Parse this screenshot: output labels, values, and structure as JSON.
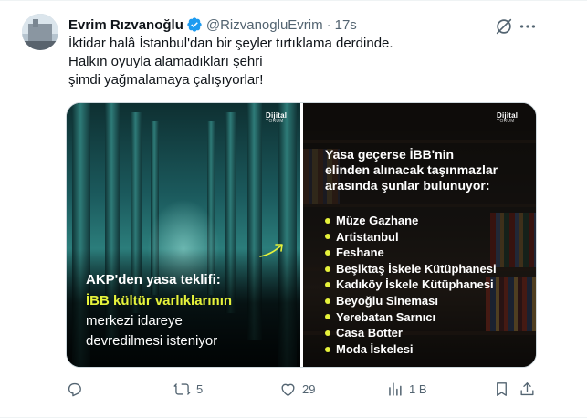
{
  "tweet": {
    "author_name": "Evrim Rızvanoğlu",
    "handle": "@RizvanogluEvrim",
    "separator": "·",
    "time": "17s",
    "text_lines": [
      "İktidar halâ İstanbul'dan bir şeyler tırtıklama derdinde.",
      "Halkın oyuyla alamadıkları şehri",
      "şimdi yağmalamaya çalışıyorlar!"
    ]
  },
  "media": {
    "left": {
      "logo": "Dijital",
      "logo_sub": "YORUM",
      "headline": "AKP'den yasa teklifi:",
      "highlight": "İBB kültür varlıklarının",
      "line3": "merkezi idareye",
      "line4": "devredilmesi isteniyor"
    },
    "right": {
      "logo": "Dijital",
      "logo_sub": "YORUM",
      "intro_lines": [
        "Yasa geçerse İBB'nin",
        "elinden alınacak taşınmazlar",
        "arasında şunlar bulunuyor:"
      ],
      "items": [
        "Müze Gazhane",
        "Artistanbul",
        "Feshane",
        "Beşiktaş İskele Kütüphanesi",
        "Kadıköy İskele Kütüphanesi",
        "Beyoğlu Sineması",
        "Yerebatan Sarnıcı",
        "Casa Botter",
        "Moda İskelesi"
      ]
    }
  },
  "actions": {
    "reply_count": "",
    "repost_count": "5",
    "like_count": "29",
    "views_count": "1 B"
  },
  "colors": {
    "verified_blue": "#1d9bf0",
    "muted_text": "#536471",
    "highlight_yellow": "#e6f23b"
  },
  "icons": [
    "verified-badge-icon",
    "grok-icon",
    "more-icon",
    "reply-icon",
    "repost-icon",
    "like-icon",
    "views-icon",
    "bookmark-icon",
    "share-icon",
    "arrow-icon"
  ]
}
